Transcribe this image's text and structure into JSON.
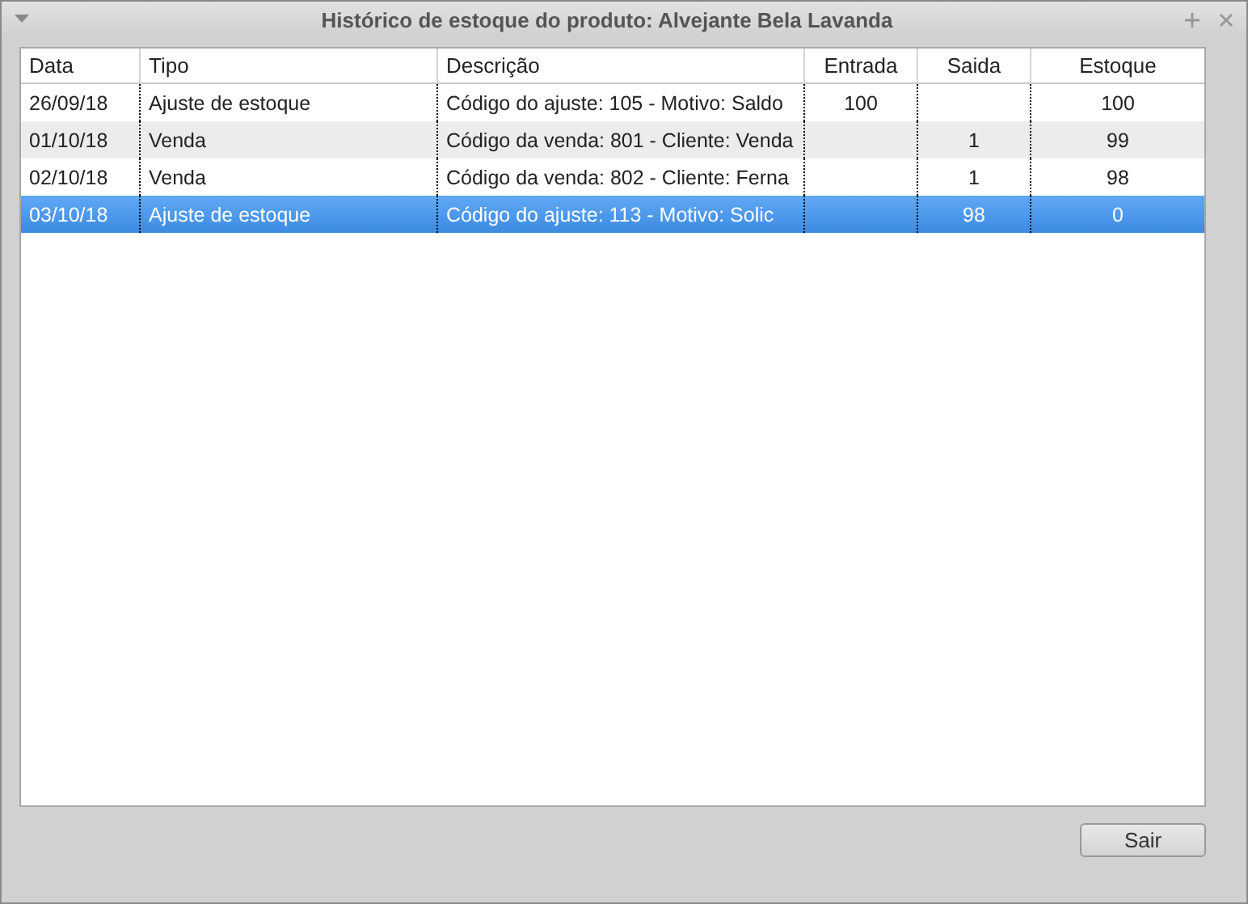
{
  "window": {
    "title": "Histórico de estoque do produto: Alvejante Bela Lavanda"
  },
  "table": {
    "columns": [
      "Data",
      "Tipo",
      "Descrição",
      "Entrada",
      "Saida",
      "Estoque"
    ],
    "rows": [
      {
        "selected": false,
        "cells": [
          "26/09/18",
          "Ajuste de estoque",
          "Código do ajuste: 105 - Motivo: Saldo",
          "100",
          "",
          "100"
        ]
      },
      {
        "selected": false,
        "cells": [
          "01/10/18",
          "Venda",
          "Código da venda: 801 - Cliente: Venda",
          "",
          "1",
          "99"
        ]
      },
      {
        "selected": false,
        "cells": [
          "02/10/18",
          "Venda",
          "Código da venda: 802 - Cliente: Ferna",
          "",
          "1",
          "98"
        ]
      },
      {
        "selected": true,
        "cells": [
          "03/10/18",
          "Ajuste de estoque",
          "Código do ajuste: 113 - Motivo: Solic",
          "",
          "98",
          "0"
        ]
      }
    ]
  },
  "buttons": [
    {
      "label": "Sair"
    }
  ]
}
